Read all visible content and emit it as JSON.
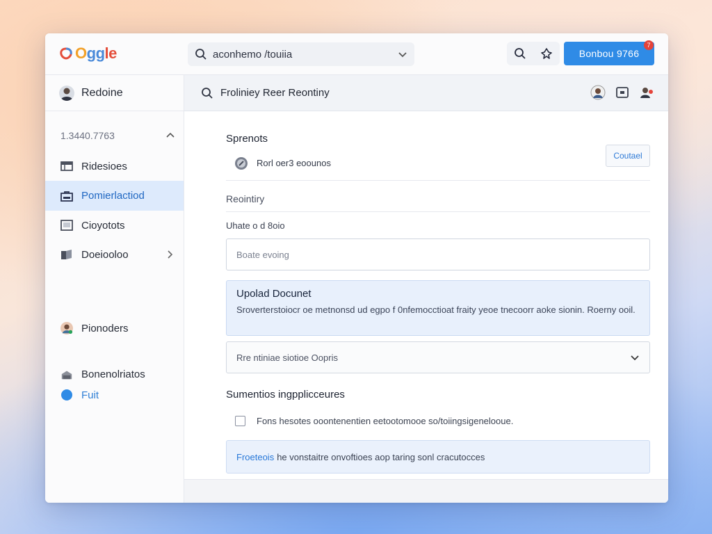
{
  "brand": {
    "name": "Oggle",
    "letters": [
      "O",
      "gg",
      "le"
    ],
    "colors": [
      "#f2a12a",
      "#4a8ad9",
      "#e44d3a"
    ]
  },
  "topbar": {
    "search_value": "aconhemo /touiia",
    "primary_button": "Bonbou 9766",
    "badge": "7",
    "icons": [
      "search-icon",
      "pin-icon"
    ]
  },
  "sidebar": {
    "user_name": "Redoine",
    "section_label": "1.3440.7763",
    "items": [
      {
        "label": "Ridesioes",
        "icon": "table-icon"
      },
      {
        "label": "Pomierlactiod",
        "icon": "folder-icon",
        "active": true
      },
      {
        "label": "Cioyotots",
        "icon": "window-icon"
      },
      {
        "label": "Doeiooloo",
        "icon": "files-icon",
        "has_chevron": true
      }
    ],
    "people_label": "Pionoders",
    "bottom_label": "Bonenolriatos",
    "bottom_link": "Fuit"
  },
  "main": {
    "header_title": "Froliniey Reer Reontiny",
    "section_title": "Sprenots",
    "service_label": "Rorl oer3 eoounos",
    "contact_button": "Coutael",
    "subsection_title": "Reointiry",
    "field_label": "Uhate o d 8oio",
    "input_placeholder": "Boate evoing",
    "card_title": "Upolad  Docunet",
    "card_desc": "Sroverterstoiocr oe metnonsd ud egpo f 0nfemocctioat fraity yeoe tnecoorr aoke sionin. Roerny ooil.",
    "select_value": "Rre ntiniae siotioe Oopris",
    "group_title": "Sumentios  ingpplicceures",
    "checkbox_label": "Fons hesotes ooontenentien eetootomooe so/toiingsigenelooue.",
    "notice_link": "Froeteois",
    "notice_text": "he vonstaitre onvoftioes aop taring sonl cracutocces"
  }
}
